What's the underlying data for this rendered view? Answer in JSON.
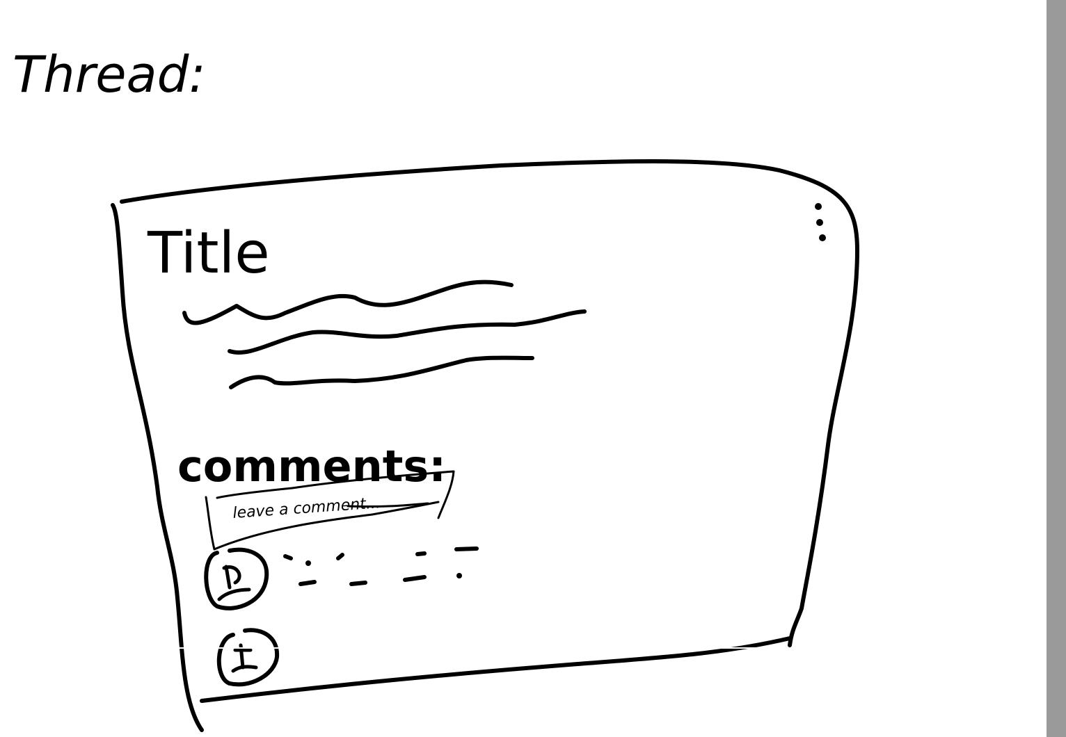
{
  "thread": {
    "heading": "Thread:"
  },
  "card": {
    "title": "Title",
    "comments_label": "comments:",
    "comment_input": {
      "placeholder": "leave a comment..."
    }
  },
  "colors": {
    "ink": "#000000",
    "background": "#ffffff",
    "scrollbar": "#9a9a9a"
  },
  "icons": {
    "menu": "kebab-menu-icon",
    "avatar": "user-avatar-icon"
  }
}
